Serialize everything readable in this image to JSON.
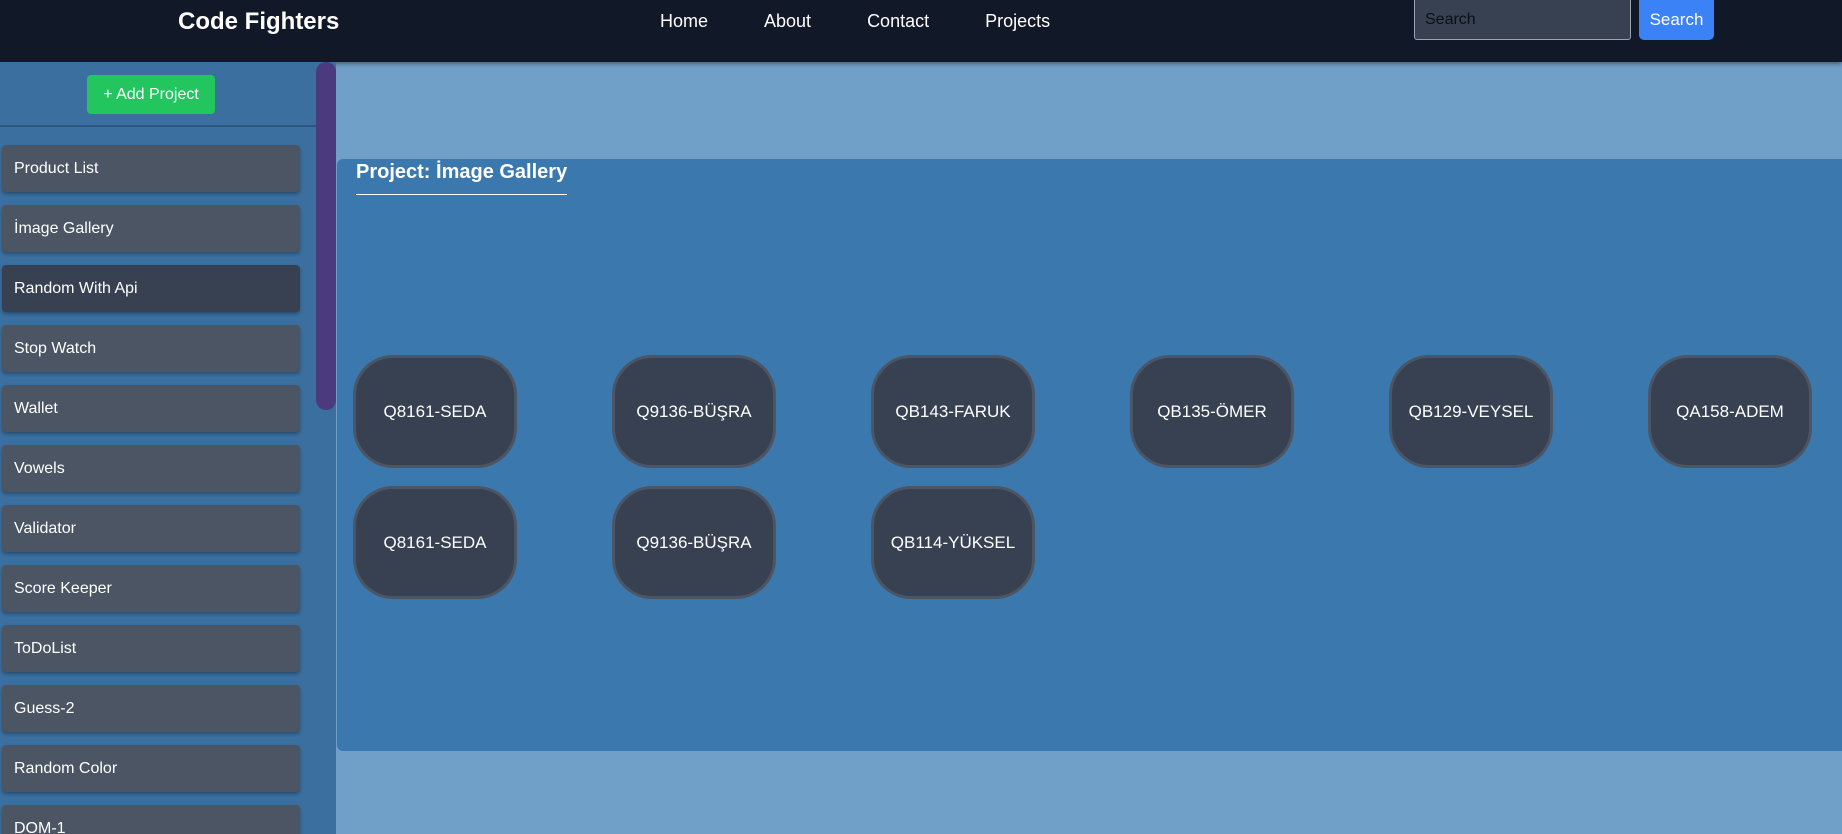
{
  "header": {
    "brand": "Code Fighters",
    "nav": [
      "Home",
      "About",
      "Contact",
      "Projects"
    ],
    "search_placeholder": "Search",
    "search_button": "Search"
  },
  "sidebar": {
    "add_project_label": "+ Add Project",
    "items": [
      "Product List",
      "İmage Gallery",
      "Random With Api",
      "Stop Watch",
      "Wallet",
      "Vowels",
      "Validator",
      "Score Keeper",
      "ToDoList",
      "Guess-2",
      "Random Color",
      "DOM-1"
    ]
  },
  "main": {
    "title": "Project: İmage Gallery",
    "gallery": [
      "Q8161-SEDA",
      "Q9136-BÜŞRA",
      "QB143-FARUK",
      "QB135-ÖMER",
      "QB129-VEYSEL",
      "QA158-ADEM",
      "Q8161-SEDA",
      "Q9136-BÜŞRA",
      "QB114-YÜKSEL"
    ]
  },
  "colors": {
    "navbar": "#111827",
    "accent_blue": "#3b82f6",
    "add_green": "#22c55e",
    "panel": "#3b78ae",
    "background": "#70a0c8"
  }
}
